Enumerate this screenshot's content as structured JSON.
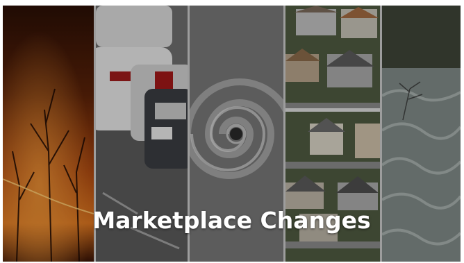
{
  "title": "Marketplace Changes",
  "panels": [
    {
      "subject": "wildfire-forest",
      "accent": "#c9571a"
    },
    {
      "subject": "parked-cars",
      "accent": "#d7d7d7"
    },
    {
      "subject": "hurricane-satellite",
      "accent": "#9a9a9a"
    },
    {
      "subject": "suburban-houses",
      "accent": "#5a7a3a"
    },
    {
      "subject": "flood-waters",
      "accent": "#6f7a78"
    }
  ]
}
